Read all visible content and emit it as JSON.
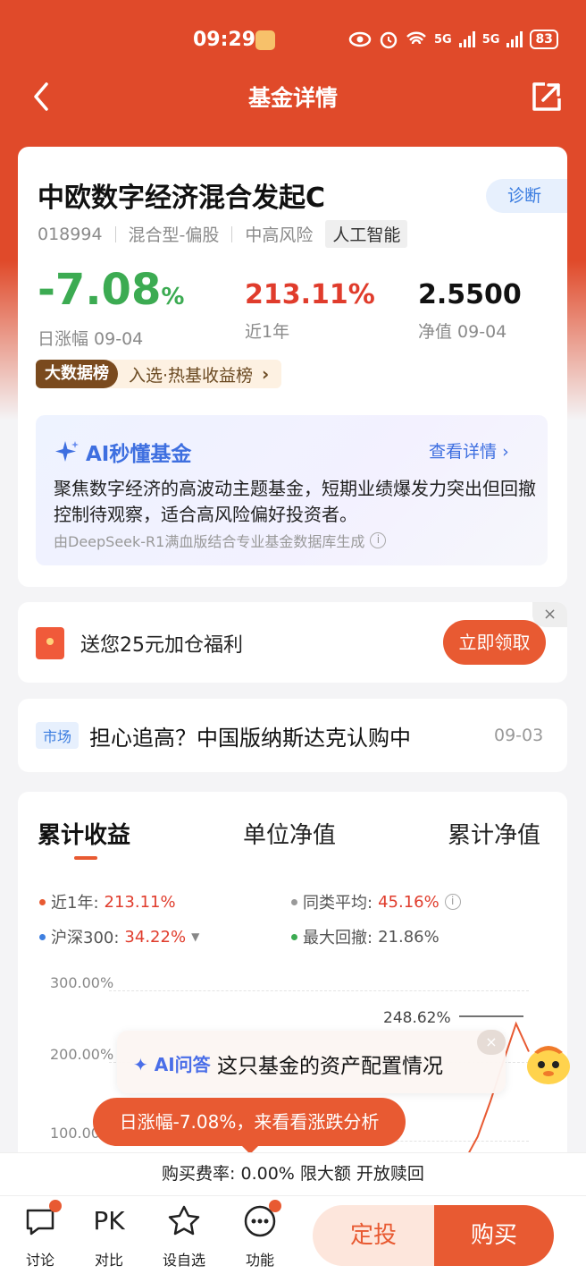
{
  "status": {
    "time": "09:29",
    "network": "5G",
    "battery": "83"
  },
  "nav": {
    "title": "基金详情"
  },
  "fund": {
    "name": "中欧数字经济混合发起C",
    "diagnose_label": "诊断",
    "code": "018994",
    "type": "混合型-偏股",
    "risk": "中高风险",
    "theme": "人工智能",
    "day_change": "-7.08",
    "day_change_unit": "%",
    "day_change_label": "日涨幅 09-04",
    "year_return": "213.11%",
    "year_return_label": "近1年",
    "nav_value": "2.5500",
    "nav_label": "净值 09-04",
    "bigdata_badge": "大数据榜",
    "bigdata_text": "入选·热基收益榜"
  },
  "ai_summary": {
    "title": "AI秒懂基金",
    "more": "查看详情",
    "text": "聚焦数字经济的高波动主题基金，短期业绩爆发力突出但回撤控制待观察，适合高风险偏好投资者。",
    "note": "由DeepSeek-R1满血版结合专业基金数据库生成"
  },
  "promo": {
    "text": "送您25元加仓福利",
    "button": "立即领取"
  },
  "news": {
    "tag": "市场",
    "text": "担心追高？中国版纳斯达克认购中",
    "date": "09-03"
  },
  "chart_tabs": [
    "累计收益",
    "单位净值",
    "累计净值"
  ],
  "legend": {
    "fund": {
      "label": "近1年:",
      "value": "213.11%"
    },
    "peer": {
      "label": "同类平均:",
      "value": "45.16%"
    },
    "hs300": {
      "label": "沪深300:",
      "value": "34.22%"
    },
    "drawdown": {
      "label": "最大回撤:",
      "value": "21.86%"
    }
  },
  "colors": {
    "accent": "#e85a32",
    "fund_line": "#e85a32",
    "up": "#e03c2c",
    "down": "#3cab52",
    "hs300": "#3e7fe0"
  },
  "chart_data": {
    "type": "line",
    "yticks": [
      "300.00%",
      "200.00%",
      "100.00%"
    ],
    "ylim": [
      0,
      300
    ],
    "peak_label": "248.62%",
    "series": [
      {
        "name": "近1年",
        "values": [
          0,
          5,
          12,
          20,
          28,
          40,
          55,
          75,
          105,
          150,
          200,
          248.62,
          213.11
        ]
      }
    ]
  },
  "ai_qa": {
    "badge": "AI问答",
    "text": "这只基金的资产配置情况"
  },
  "drop_tip": "日涨幅-7.08%，来看看涨跌分析",
  "fee_bar": "购买费率: 0.00% 限大额 开放赎回",
  "bottom_nav": [
    {
      "label": "讨论",
      "icon": "chat-icon"
    },
    {
      "label": "对比",
      "icon": "pk-icon",
      "glyph": "PK"
    },
    {
      "label": "设自选",
      "icon": "star-icon"
    },
    {
      "label": "功能",
      "icon": "more-icon"
    }
  ],
  "actions": {
    "dingtou": "定投",
    "buy": "购买"
  }
}
